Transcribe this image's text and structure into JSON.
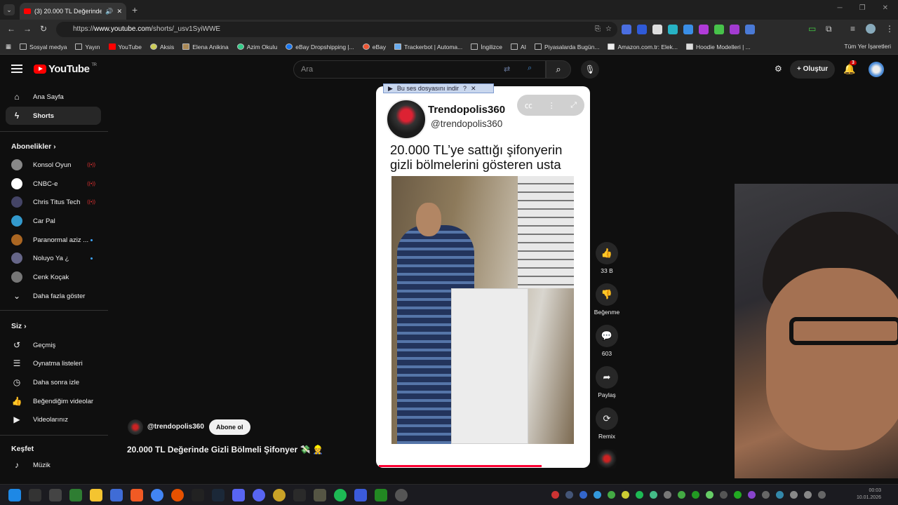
{
  "browser": {
    "tab_title": "(3) 20.000 TL Değerinde Gi",
    "url_prefix": "https://",
    "url_host": "www.youtube.com",
    "url_path": "/shorts/_usv1SyiWWE",
    "bookmarks": [
      "Sosyal medya",
      "Yayın",
      "YouTube",
      "Aksis",
      "Elena Anikina",
      "Azim Okulu",
      "eBay Dropshipping |...",
      "eBay",
      "Trackerbot | Automa...",
      "İngilizce",
      "AI",
      "Piyasalarda Bugün...",
      "Amazon.com.tr: Elek...",
      "Hoodie Modelleri | ..."
    ],
    "all_bookmarks": "Tüm Yer İşaretleri"
  },
  "header": {
    "logo": "YouTube",
    "region": "TR",
    "search_placeholder": "Ara",
    "create_label": "Oluştur",
    "notifications": "3"
  },
  "sidebar": {
    "main": [
      {
        "label": "Ana Sayfa",
        "icon": "home-icon"
      },
      {
        "label": "Shorts",
        "icon": "shorts-icon"
      }
    ],
    "subscriptions_title": "Abonelikler",
    "subscriptions": [
      {
        "label": "Konsol Oyun",
        "badge": "live"
      },
      {
        "label": "CNBC-e",
        "badge": "live"
      },
      {
        "label": "Chris Titus Tech",
        "badge": "live"
      },
      {
        "label": "Car Pal",
        "badge": ""
      },
      {
        "label": "Paranormal aziz ...",
        "badge": "dot"
      },
      {
        "label": "Noluyo Ya ¿",
        "badge": "dot"
      },
      {
        "label": "Cenk Koçak",
        "badge": ""
      }
    ],
    "show_more": "Daha fazla göster",
    "you_title": "Siz",
    "you_items": [
      "Geçmiş",
      "Oynatma listeleri",
      "Daha sonra izle",
      "Beğendiğim videolar",
      "Videolarınız"
    ],
    "explore_title": "Keşfet",
    "explore_items": [
      "Müzik"
    ]
  },
  "short": {
    "download_bar": "Bu ses dosyasını indir",
    "channel_name": "Trendopolis360",
    "channel_handle": "@trendopolis360",
    "headline": "20.000 TL’ye sattığı şifonyerin gizli bölmelerini gösteren usta",
    "likes": "33 B",
    "dislike_label": "Beğenme",
    "comments": "603",
    "share_label": "Paylaş",
    "remix_label": "Remix",
    "progress": 0.78
  },
  "meta": {
    "handle": "@trendopolis360",
    "subscribe": "Abone ol",
    "title": "20.000 TL Değerinde Gizli Bölmeli Şifonyer"
  },
  "taskbar": {
    "time": "00:03",
    "date": "10.01.2026"
  }
}
